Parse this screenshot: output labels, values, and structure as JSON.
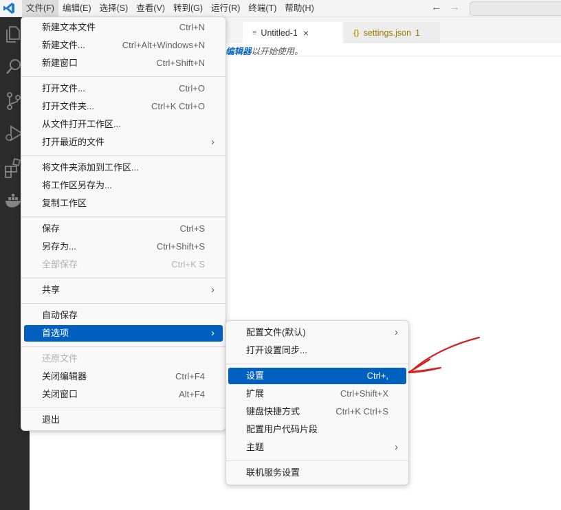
{
  "menubar": {
    "items": [
      "文件(F)",
      "编辑(E)",
      "选择(S)",
      "查看(V)",
      "转到(G)",
      "运行(R)",
      "终端(T)",
      "帮助(H)"
    ]
  },
  "nav": {
    "back": "←",
    "forward": "→"
  },
  "tabs": [
    {
      "label": "Untitled-1",
      "icon": "≡",
      "close": "×"
    },
    {
      "label": "settings.json",
      "icon": "{}",
      "count": "1"
    }
  ],
  "editor": {
    "hint_link": "编辑器",
    "hint_text": "以开始使用。"
  },
  "file_menu": {
    "groups": [
      [
        {
          "label": "新建文本文件",
          "shortcut": "Ctrl+N"
        },
        {
          "label": "新建文件...",
          "shortcut": "Ctrl+Alt+Windows+N"
        },
        {
          "label": "新建窗口",
          "shortcut": "Ctrl+Shift+N"
        }
      ],
      [
        {
          "label": "打开文件...",
          "shortcut": "Ctrl+O"
        },
        {
          "label": "打开文件夹...",
          "shortcut": "Ctrl+K Ctrl+O"
        },
        {
          "label": "从文件打开工作区..."
        },
        {
          "label": "打开最近的文件",
          "chevron": "›"
        }
      ],
      [
        {
          "label": "将文件夹添加到工作区..."
        },
        {
          "label": "将工作区另存为..."
        },
        {
          "label": "复制工作区"
        }
      ],
      [
        {
          "label": "保存",
          "shortcut": "Ctrl+S"
        },
        {
          "label": "另存为...",
          "shortcut": "Ctrl+Shift+S"
        },
        {
          "label": "全部保存",
          "shortcut": "Ctrl+K S",
          "disabled": true
        }
      ],
      [
        {
          "label": "共享",
          "chevron": "›"
        }
      ],
      [
        {
          "label": "自动保存"
        },
        {
          "label": "首选项",
          "chevron": "›",
          "highlighted": true
        }
      ],
      [
        {
          "label": "还原文件",
          "disabled": true
        },
        {
          "label": "关闭编辑器",
          "shortcut": "Ctrl+F4"
        },
        {
          "label": "关闭窗口",
          "shortcut": "Alt+F4"
        }
      ],
      [
        {
          "label": "退出"
        }
      ]
    ]
  },
  "preferences_menu": {
    "groups": [
      [
        {
          "label": "配置文件(默认)",
          "chevron": "›"
        },
        {
          "label": "打开设置同步..."
        }
      ],
      [
        {
          "label": "设置",
          "shortcut": "Ctrl+,",
          "highlighted": true
        },
        {
          "label": "扩展",
          "shortcut": "Ctrl+Shift+X"
        },
        {
          "label": "键盘快捷方式",
          "shortcut": "Ctrl+K Ctrl+S"
        },
        {
          "label": "配置用户代码片段"
        },
        {
          "label": "主题",
          "chevron": "›"
        }
      ],
      [
        {
          "label": "联机服务设置"
        }
      ]
    ]
  },
  "colors": {
    "accent": "#0060c0",
    "activitybar": "#2c2c2c",
    "annotation": "#d42020"
  }
}
